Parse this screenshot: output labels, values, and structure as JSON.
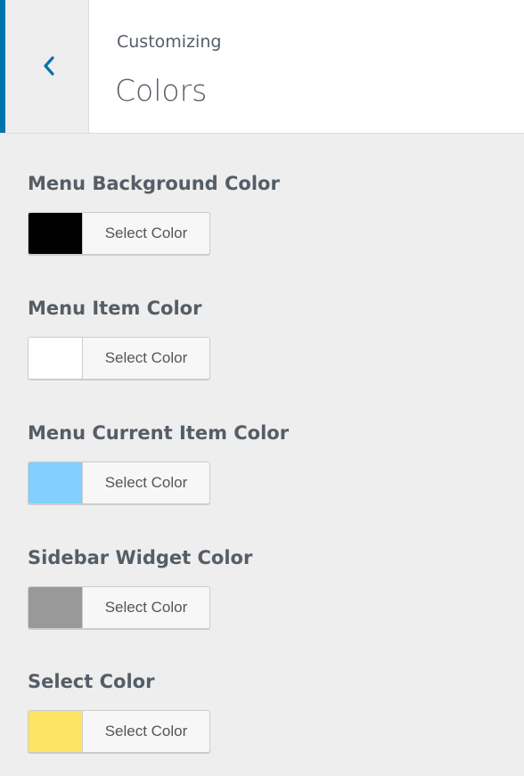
{
  "header": {
    "subtitle": "Customizing",
    "title": "Colors",
    "accent_color": "#0073aa"
  },
  "controls": [
    {
      "label": "Menu Background Color",
      "button_label": "Select Color",
      "color": "#000000"
    },
    {
      "label": "Menu Item Color",
      "button_label": "Select Color",
      "color": "#ffffff"
    },
    {
      "label": "Menu Current Item Color",
      "button_label": "Select Color",
      "color": "#81d0ff"
    },
    {
      "label": "Sidebar Widget Color",
      "button_label": "Select Color",
      "color": "#999999"
    },
    {
      "label": "Select Color",
      "button_label": "Select Color",
      "color": "#fde464"
    }
  ]
}
